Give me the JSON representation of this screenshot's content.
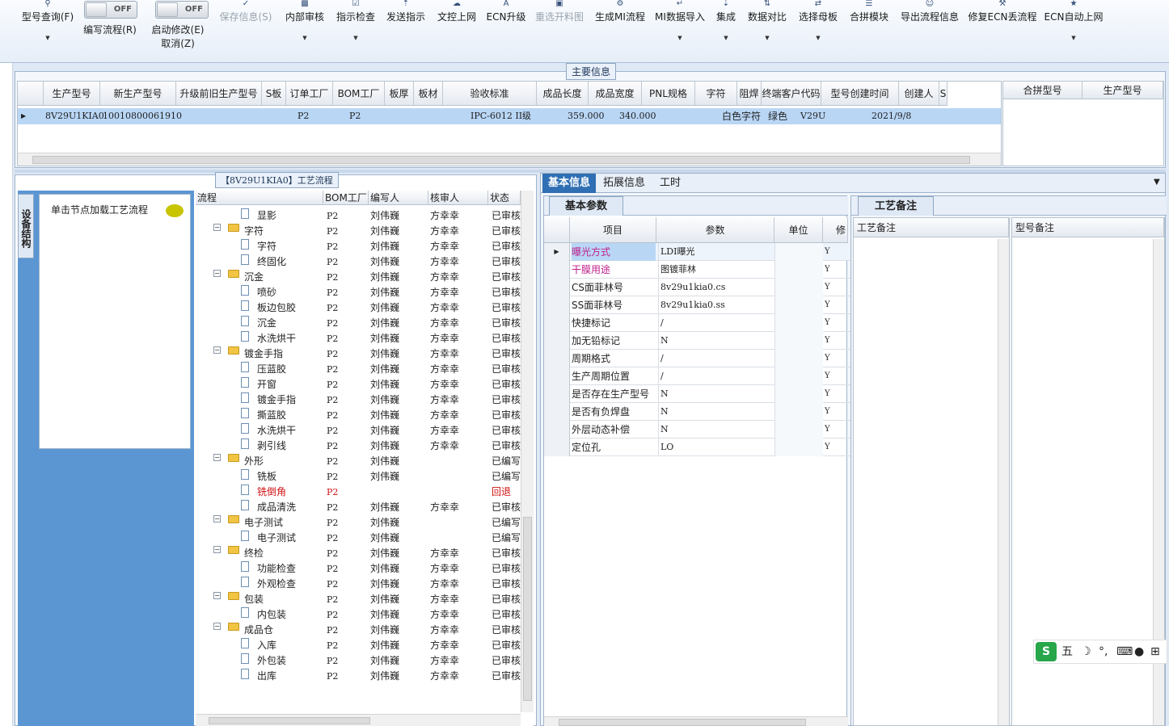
{
  "toolbar": {
    "query": "型号查询(F)",
    "edit_flow": "编写流程(R)",
    "start_modify": "启动修改(E)",
    "cancel": "取消(Z)",
    "toggle_off": "OFF",
    "save_info": "保存信息(S)",
    "internal_review": "内部审核",
    "instruction_check": "指示检查",
    "send_instruction": "发送指示",
    "doc_online": "文控上网",
    "ecn_upgrade": "ECN升级",
    "reselect_cut": "重选开料图",
    "gen_mi": "生成MI流程",
    "mi_import": "MI数据导入",
    "integrate": "集成",
    "data_compare": "数据对比",
    "select_mother": "选择母板",
    "merge_module": "合拼模块",
    "export_flow": "导出流程信息",
    "fix_ecn": "修复ECN丢流程",
    "ecn_auto": "ECN自动上网"
  },
  "main_info": {
    "title": "主要信息",
    "headers": [
      "生产型号",
      "新生产型号",
      "升级前旧生产型号",
      "S板",
      "订单工厂",
      "BOM工厂",
      "板厚",
      "板材",
      "验收标准",
      "成品长度",
      "成品宽度",
      "PNL规格",
      "字符",
      "阻焊",
      "终端客户代码",
      "型号创建时间",
      "创建人",
      "S"
    ],
    "row": {
      "prod_no": "8V29U1KIA0",
      "new_no": "10010800061910",
      "order_factory": "P2",
      "bom_factory": "P2",
      "standard": "IPC-6012 II级",
      "length": "359.000",
      "width": "340.000",
      "char": "白色字符",
      "mask": "绿色",
      "customer": "V29U",
      "created": "2021/9/8"
    },
    "merge_headers": [
      "合拼型号",
      "生产型号"
    ]
  },
  "left_panel": {
    "vertical_tab": "设备结构",
    "hint": "单击节点加载工艺流程"
  },
  "flow": {
    "title": "【8V29U1KIA0】工艺流程",
    "headers": [
      "流程",
      "BOM工厂",
      "编写人",
      "核审人",
      "状态"
    ],
    "rows": [
      {
        "name": "显影",
        "level": 2,
        "factory": "P2",
        "writer": "刘伟巍",
        "reviewer": "方幸幸",
        "status": "已审核"
      },
      {
        "name": "字符",
        "level": 1,
        "factory": "P2",
        "writer": "刘伟巍",
        "reviewer": "方幸幸",
        "status": "已审核"
      },
      {
        "name": "字符",
        "level": 2,
        "factory": "P2",
        "writer": "刘伟巍",
        "reviewer": "方幸幸",
        "status": "已审核"
      },
      {
        "name": "终固化",
        "level": 2,
        "factory": "P2",
        "writer": "刘伟巍",
        "reviewer": "方幸幸",
        "status": "已审核"
      },
      {
        "name": "沉金",
        "level": 1,
        "factory": "P2",
        "writer": "刘伟巍",
        "reviewer": "方幸幸",
        "status": "已审核"
      },
      {
        "name": "喷砂",
        "level": 2,
        "factory": "P2",
        "writer": "刘伟巍",
        "reviewer": "方幸幸",
        "status": "已审核"
      },
      {
        "name": "板边包胶",
        "level": 2,
        "factory": "P2",
        "writer": "刘伟巍",
        "reviewer": "方幸幸",
        "status": "已审核"
      },
      {
        "name": "沉金",
        "level": 2,
        "factory": "P2",
        "writer": "刘伟巍",
        "reviewer": "方幸幸",
        "status": "已审核"
      },
      {
        "name": "水洗烘干",
        "level": 2,
        "factory": "P2",
        "writer": "刘伟巍",
        "reviewer": "方幸幸",
        "status": "已审核"
      },
      {
        "name": "镀金手指",
        "level": 1,
        "factory": "P2",
        "writer": "刘伟巍",
        "reviewer": "方幸幸",
        "status": "已审核"
      },
      {
        "name": "压蓝胶",
        "level": 2,
        "factory": "P2",
        "writer": "刘伟巍",
        "reviewer": "方幸幸",
        "status": "已审核"
      },
      {
        "name": "开窗",
        "level": 2,
        "factory": "P2",
        "writer": "刘伟巍",
        "reviewer": "方幸幸",
        "status": "已审核"
      },
      {
        "name": "镀金手指",
        "level": 2,
        "factory": "P2",
        "writer": "刘伟巍",
        "reviewer": "方幸幸",
        "status": "已审核"
      },
      {
        "name": "撕蓝胶",
        "level": 2,
        "factory": "P2",
        "writer": "刘伟巍",
        "reviewer": "方幸幸",
        "status": "已审核"
      },
      {
        "name": "水洗烘干",
        "level": 2,
        "factory": "P2",
        "writer": "刘伟巍",
        "reviewer": "方幸幸",
        "status": "已审核"
      },
      {
        "name": "剥引线",
        "level": 2,
        "factory": "P2",
        "writer": "刘伟巍",
        "reviewer": "方幸幸",
        "status": "已审核"
      },
      {
        "name": "外形",
        "level": 1,
        "factory": "P2",
        "writer": "刘伟巍",
        "reviewer": "",
        "status": "已编写"
      },
      {
        "name": "铣板",
        "level": 2,
        "factory": "P2",
        "writer": "刘伟巍",
        "reviewer": "",
        "status": "已编写"
      },
      {
        "name": "铣倒角",
        "level": 2,
        "factory": "P2",
        "writer": "",
        "reviewer": "",
        "status": "回退",
        "red": true
      },
      {
        "name": "成品清洗",
        "level": 2,
        "factory": "P2",
        "writer": "刘伟巍",
        "reviewer": "方幸幸",
        "status": "已审核"
      },
      {
        "name": "电子测试",
        "level": 1,
        "factory": "P2",
        "writer": "刘伟巍",
        "reviewer": "",
        "status": "已编写"
      },
      {
        "name": "电子测试",
        "level": 2,
        "factory": "P2",
        "writer": "刘伟巍",
        "reviewer": "",
        "status": "已编写"
      },
      {
        "name": "终检",
        "level": 1,
        "factory": "P2",
        "writer": "刘伟巍",
        "reviewer": "方幸幸",
        "status": "已审核"
      },
      {
        "name": "功能检查",
        "level": 2,
        "factory": "P2",
        "writer": "刘伟巍",
        "reviewer": "方幸幸",
        "status": "已审核"
      },
      {
        "name": "外观检查",
        "level": 2,
        "factory": "P2",
        "writer": "刘伟巍",
        "reviewer": "方幸幸",
        "status": "已审核"
      },
      {
        "name": "包装",
        "level": 1,
        "factory": "P2",
        "writer": "刘伟巍",
        "reviewer": "方幸幸",
        "status": "已审核"
      },
      {
        "name": "内包装",
        "level": 2,
        "factory": "P2",
        "writer": "刘伟巍",
        "reviewer": "方幸幸",
        "status": "已审核"
      },
      {
        "name": "成品仓",
        "level": 1,
        "factory": "P2",
        "writer": "刘伟巍",
        "reviewer": "方幸幸",
        "status": "已审核"
      },
      {
        "name": "入库",
        "level": 2,
        "factory": "P2",
        "writer": "刘伟巍",
        "reviewer": "方幸幸",
        "status": "已审核"
      },
      {
        "name": "外包装",
        "level": 2,
        "factory": "P2",
        "writer": "刘伟巍",
        "reviewer": "方幸幸",
        "status": "已审核"
      },
      {
        "name": "出库",
        "level": 2,
        "factory": "P2",
        "writer": "刘伟巍",
        "reviewer": "方幸幸",
        "status": "已审核"
      }
    ]
  },
  "tabs": [
    "基本信息",
    "拓展信息",
    "工时"
  ],
  "basic": {
    "subtab": "基本参数",
    "headers": [
      "项目",
      "参数",
      "单位",
      "修"
    ],
    "rows": [
      {
        "item": "曝光方式",
        "value": "LDI曝光",
        "flag": "Y",
        "color": "#c0208a"
      },
      {
        "item": "干膜用途",
        "value": "图镀菲林",
        "flag": "Y",
        "color": "#c0208a"
      },
      {
        "item": "CS面菲林号",
        "value": "8v29u1kia0.cs",
        "flag": "Y"
      },
      {
        "item": "SS面菲林号",
        "value": "8v29u1kia0.ss",
        "flag": "Y"
      },
      {
        "item": "快捷标记",
        "value": "/",
        "flag": "Y"
      },
      {
        "item": "加无铅标记",
        "value": "N",
        "flag": "Y"
      },
      {
        "item": "周期格式",
        "value": "/",
        "flag": "Y"
      },
      {
        "item": "生产周期位置",
        "value": "/",
        "flag": "Y"
      },
      {
        "item": "是否存在生产型号",
        "value": "N",
        "flag": "Y"
      },
      {
        "item": "是否有负焊盘",
        "value": "N",
        "flag": "Y"
      },
      {
        "item": "外层动态补偿",
        "value": "N",
        "flag": "Y"
      },
      {
        "item": "定位孔",
        "value": "LO",
        "flag": "Y"
      }
    ]
  },
  "notes": {
    "tab": "工艺备注",
    "headers": [
      "工艺备注",
      "型号备注"
    ]
  },
  "ime": {
    "mode": "五"
  }
}
